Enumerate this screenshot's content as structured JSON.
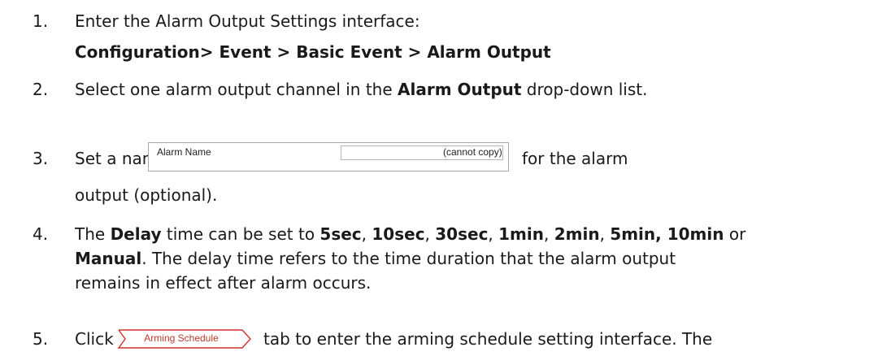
{
  "steps": [
    {
      "num": "1.",
      "text": "Enter the Alarm Output Settings interface:"
    },
    {
      "path": "Configuration> Event > Basic Event > Alarm Output"
    },
    {
      "num": "2.",
      "pre": "Select one alarm output channel in the ",
      "bold": "Alarm Output",
      "post": " drop-down list."
    },
    {
      "num": "3.",
      "pre": "Set a name in",
      "post": "for the alarm",
      "cont": "output (optional)."
    },
    {
      "num": "4.",
      "l1": [
        {
          "t": "The ",
          "b": false
        },
        {
          "t": "Delay",
          "b": true
        },
        {
          "t": " time can be set to ",
          "b": false
        },
        {
          "t": "5sec",
          "b": true
        },
        {
          "t": ", ",
          "b": false
        },
        {
          "t": "10sec",
          "b": true
        },
        {
          "t": ", ",
          "b": false
        },
        {
          "t": "30sec",
          "b": true
        },
        {
          "t": ", ",
          "b": false
        },
        {
          "t": "1min",
          "b": true
        },
        {
          "t": ", ",
          "b": false
        },
        {
          "t": "2min",
          "b": true
        },
        {
          "t": ", ",
          "b": false
        },
        {
          "t": "5min, 10min",
          "b": true
        },
        {
          "t": " or",
          "b": false
        }
      ],
      "l2": [
        {
          "t": "Manual",
          "b": true
        },
        {
          "t": ". The delay time refers to the time duration that the alarm output",
          "b": false
        }
      ],
      "l3": "remains in effect after alarm occurs."
    },
    {
      "num": "5.",
      "pre": "Click",
      "post": "tab to enter the arming schedule setting interface. The"
    }
  ],
  "alarm_name_widget": {
    "label": "Alarm Name",
    "value": "",
    "hint": "(cannot copy)"
  },
  "arming_tab": {
    "label": "Arming Schedule",
    "border_color": "#d0302a"
  }
}
